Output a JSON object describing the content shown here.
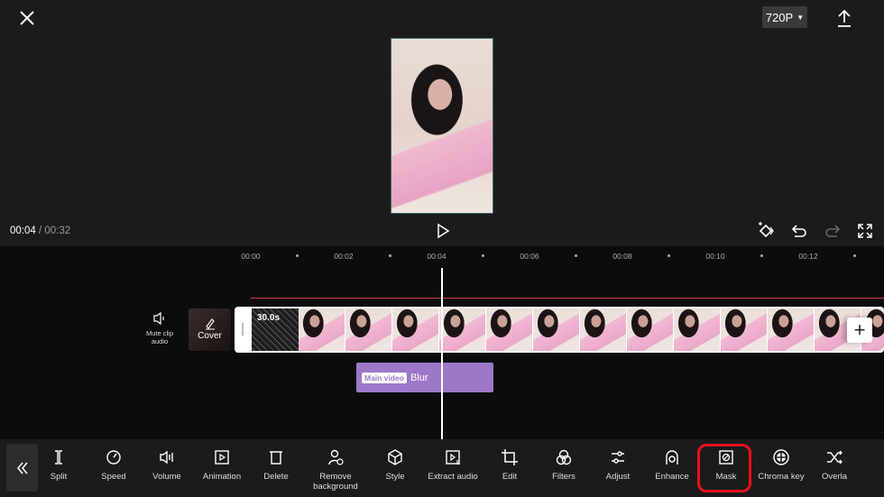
{
  "header": {
    "resolution": "720P",
    "close_icon": "close-icon",
    "export_icon": "upload-icon"
  },
  "player": {
    "current_time": "00:04",
    "separator": " / ",
    "total_time": "00:32"
  },
  "controls": [
    "keyframe-icon",
    "undo-icon",
    "redo-icon",
    "fullscreen-icon"
  ],
  "timeline": {
    "ruler": [
      "00:00",
      "00:02",
      "00:04",
      "00:06",
      "00:08",
      "00:10",
      "00:12"
    ],
    "mute_label": "Mute clip audio",
    "cover_label": "Cover",
    "clip_duration": "30.0s",
    "add_label": "+",
    "effect_tag": "Main video",
    "effect_name": "Blur"
  },
  "toolbar": {
    "items": [
      "Split",
      "Speed",
      "Volume",
      "Animation",
      "Delete",
      "Remove background",
      "Style",
      "Extract audio",
      "Edit",
      "Filters",
      "Adjust",
      "Enhance",
      "Mask",
      "Chroma key",
      "Overla"
    ],
    "highlighted": "Mask",
    "highlight_color": "#e8101a"
  }
}
